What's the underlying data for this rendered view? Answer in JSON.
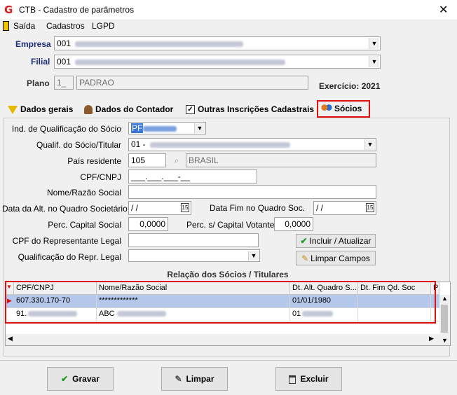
{
  "window": {
    "title": "CTB - Cadastro de parâmetros",
    "close": "✕"
  },
  "menu": {
    "exit": "Saída",
    "cadastros": "Cadastros",
    "lgpd": "LGPD"
  },
  "header": {
    "empresa_label": "Empresa",
    "empresa_value": "001",
    "filial_label": "Filial",
    "filial_value": "001",
    "plano_label": "Plano",
    "plano_code": "1_",
    "plano_name": "PADRAO",
    "exercicio_label": "Exercício: 2021"
  },
  "tabs": [
    {
      "label": "Dados gerais"
    },
    {
      "label": "Dados do Contador"
    },
    {
      "label": "Outras Inscrições Cadastrais"
    },
    {
      "label": "Sócios"
    }
  ],
  "form": {
    "ind_qualif_label": "Ind. de Qualificação do Sócio",
    "ind_qualif_value": "PF",
    "qualif_label": "Qualif. do Sócio/Titular",
    "qualif_value": "01 -",
    "pais_label": "País residente",
    "pais_code": "105",
    "pais_name": "BRASIL",
    "cpf_label": "CPF/CNPJ",
    "cpf_value": "___.___.___-__",
    "nome_label": "Nome/Razão Social",
    "nome_value": "",
    "data_alt_label": "Data da Alt. no Quadro Societário",
    "data_alt_value": " /  /",
    "data_fim_label": "Data Fim no Quadro Soc.",
    "data_fim_value": " /  /",
    "perc_cap_label": "Perc. Capital Social",
    "perc_cap_value": "0,0000",
    "perc_vot_label": "Perc. s/ Capital Votante",
    "perc_vot_value": "0,0000",
    "cpf_repr_label": "CPF do Representante Legal",
    "cpf_repr_value": "",
    "qualif_repr_label": "Qualificação do Repr. Legal",
    "qualif_repr_value": "",
    "incluir_label": "Incluir / Atualizar",
    "limpar_campos_label": "Limpar Campos",
    "calendar_label": "15"
  },
  "grid": {
    "title": "Relação dos Sócios / Titulares",
    "columns": [
      "CPF/CNPJ",
      "Nome/Razão Social",
      "Dt. Alt. Quadro S...",
      "Dt. Fim Qd. Soc",
      "P"
    ],
    "rows": [
      {
        "cpf": "607.330.170-70",
        "nome": "*************",
        "dt_alt": "01/01/1980",
        "dt_fim": ""
      },
      {
        "cpf": "91.",
        "nome": "ABC",
        "dt_alt": "01",
        "dt_fim": ""
      }
    ]
  },
  "footer": {
    "gravar": "Gravar",
    "limpar": "Limpar",
    "excluir": "Excluir"
  },
  "colors": {
    "accent": "#1f2d7a",
    "highlight": "#e01010",
    "selected_row": "#b5c8ec"
  }
}
